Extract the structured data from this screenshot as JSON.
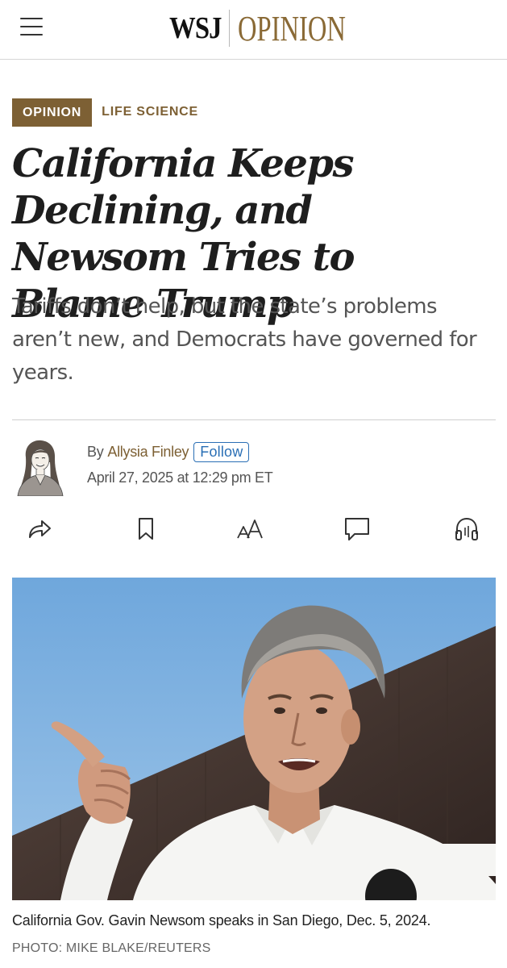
{
  "header": {
    "brand_wsj": "WSJ",
    "brand_section": "OPINION",
    "menu_icon": "hamburger-menu-icon"
  },
  "section": {
    "primary": "OPINION",
    "secondary": "LIFE SCIENCE"
  },
  "article": {
    "headline": "California Keeps Declining, and Newsom Tries to Blame Trump",
    "dek": "Tariffs don’t help, but the state’s problems aren’t new, and Democrats have governed for years.",
    "by_prefix": "By",
    "author": "Allysia Finley",
    "follow_label": "Follow",
    "timestamp": "April 27, 2025 at 12:29 pm ET"
  },
  "toolbar": {
    "share_icon": "share-icon",
    "bookmark_icon": "bookmark-icon",
    "text_size_icon": "text-size-icon",
    "comments_icon": "comment-icon",
    "listen_icon": "headphones-icon"
  },
  "media": {
    "caption": "California Gov. Gavin Newsom speaks in San Diego, Dec. 5, 2024.",
    "credit": "PHOTO: MIKE BLAKE/REUTERS"
  },
  "colors": {
    "opinion_brown": "#7d6034",
    "follow_blue": "#2a6fb5",
    "sky_blue": "#7fb0de"
  }
}
